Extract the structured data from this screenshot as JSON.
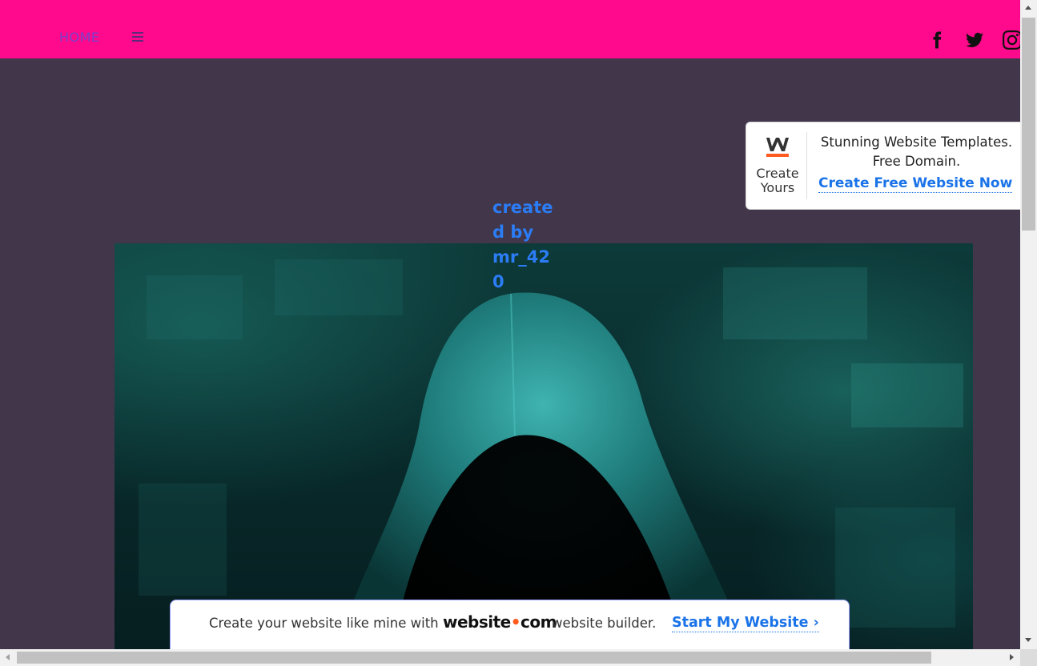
{
  "nav": {
    "home_label": "HOME",
    "menu_icon": "hamburger-menu-icon",
    "social_icons": [
      "facebook-icon",
      "twitter-icon",
      "instagram-icon"
    ]
  },
  "main": {
    "credit_text": "created by mr_420",
    "hero_image": "hooded-figure-image"
  },
  "promo": {
    "logo_letter": "W",
    "create_label": "Create Yours",
    "headline": "Stunning Website Templates. Free Domain.",
    "cta_label": "Create Free Website Now"
  },
  "banner": {
    "text": "Create your website like mine with",
    "logo_word1": "website",
    "logo_dot": "•",
    "logo_word2": "com",
    "suffix": "website builder.",
    "cta_label": "Start My Website ›"
  },
  "colors": {
    "topbar": "#ff0a8c",
    "page_bg": "#41364a",
    "credit_text": "#2b7cf5",
    "link_blue": "#1a73e8",
    "brand_orange": "#ff5a1f"
  }
}
